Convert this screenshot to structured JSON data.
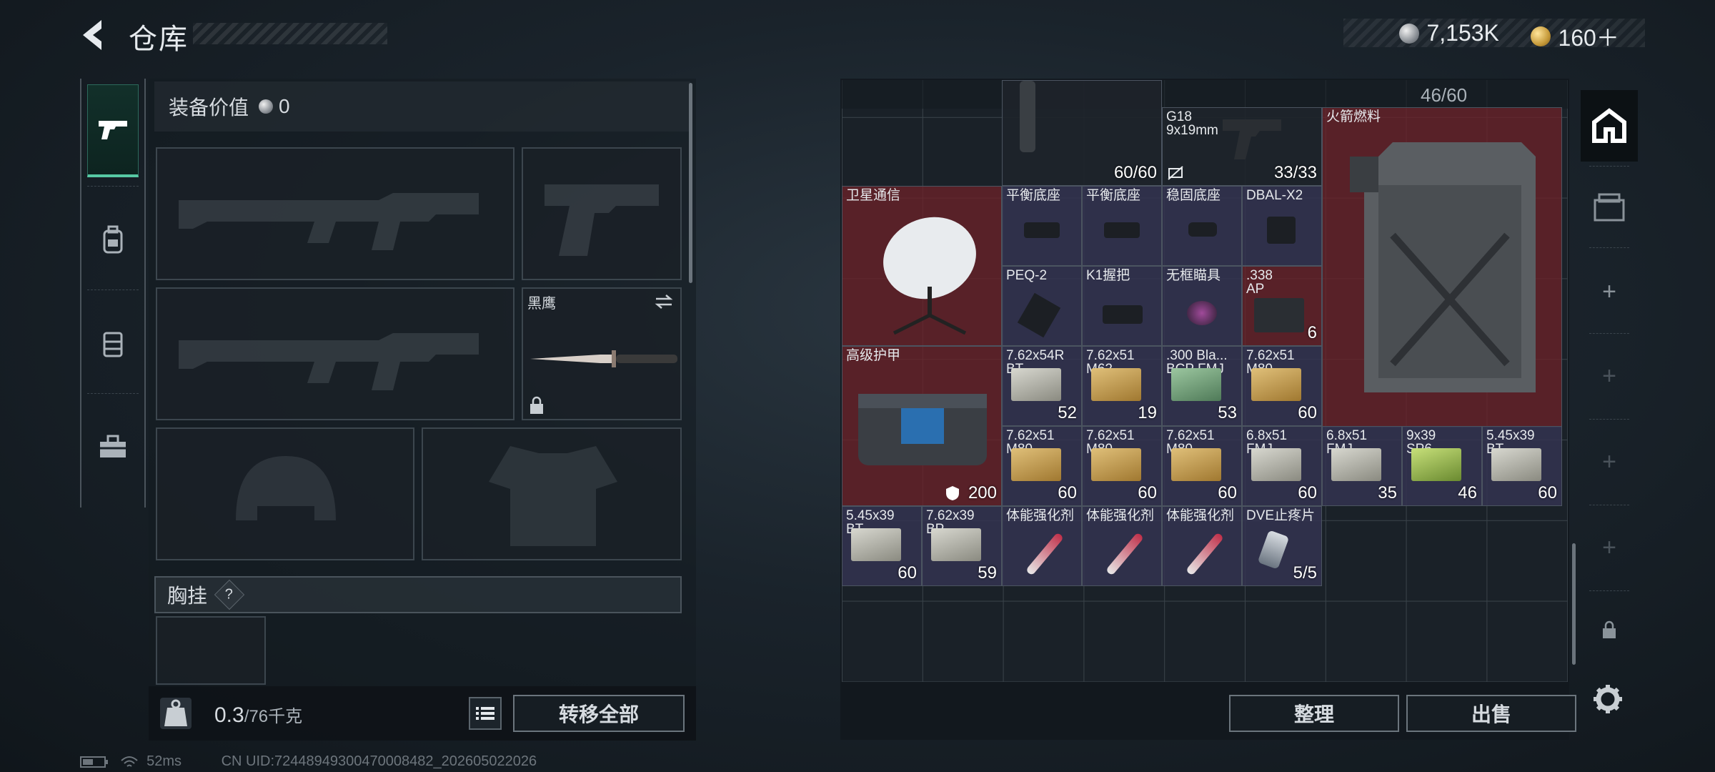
{
  "header": {
    "title": "仓库",
    "silver_amount": "7,153K",
    "gold_amount": "160＋"
  },
  "left_tabs": [
    "weapons",
    "backpack",
    "rig",
    "toolbox"
  ],
  "equipment": {
    "value_label": "装备价值",
    "value_amount": "0",
    "melee_name": "黑鹰",
    "chest_rig_label": "胸挂",
    "question_mark": "?",
    "weight_current": "0.3",
    "weight_max": "/76千克",
    "transfer_all_label": "转移全部"
  },
  "status": {
    "ping": "52ms",
    "uid": "CN UID:7244894930047000848​2_202605022026"
  },
  "stash": {
    "top_counter": "46/60",
    "items": [
      {
        "name": "",
        "count": "60/60",
        "color": "dark"
      },
      {
        "name": "G18\n9x19mm",
        "count": "33/33",
        "color": "dark"
      },
      {
        "name": "火箭燃料",
        "count": "",
        "color": "red"
      },
      {
        "name": "卫星通信",
        "count": "",
        "color": "red"
      },
      {
        "name": "平衡底座",
        "count": "",
        "color": "purple"
      },
      {
        "name": "平衡底座",
        "count": "",
        "color": "purple"
      },
      {
        "name": "稳固底座",
        "count": "",
        "color": "purple"
      },
      {
        "name": "DBAL-X2",
        "count": "",
        "color": "purple"
      },
      {
        "name": "PEQ-2",
        "count": "",
        "color": "purple"
      },
      {
        "name": "K1握把",
        "count": "",
        "color": "purple"
      },
      {
        "name": "无框瞄具",
        "count": "",
        "color": "purple"
      },
      {
        "name": ".338\nAP",
        "count": "6",
        "color": "red"
      },
      {
        "name": "高级护甲",
        "count": "200",
        "color": "red"
      },
      {
        "name": "7.62x54R\nBT",
        "count": "52",
        "color": "purple"
      },
      {
        "name": "7.62x51\nM62",
        "count": "19",
        "color": "purple"
      },
      {
        "name": ".300 Bla...\nBCP FMJ",
        "count": "53",
        "color": "purple"
      },
      {
        "name": "7.62x51\nM80",
        "count": "60",
        "color": "purple"
      },
      {
        "name": "7.62x51\nM80",
        "count": "60",
        "color": "purple"
      },
      {
        "name": "7.62x51\nM80",
        "count": "60",
        "color": "purple"
      },
      {
        "name": "7.62x51\nM80",
        "count": "60",
        "color": "purple"
      },
      {
        "name": "6.8x51\nFMJ",
        "count": "60",
        "color": "purple"
      },
      {
        "name": "6.8x51\nFMJ",
        "count": "35",
        "color": "purple"
      },
      {
        "name": "9x39\nSP6",
        "count": "46",
        "color": "purple"
      },
      {
        "name": "5.45x39\nBT",
        "count": "60",
        "color": "purple"
      },
      {
        "name": "5.45x39\nBT",
        "count": "60",
        "color": "purple"
      },
      {
        "name": "7.62x39\nBP",
        "count": "59",
        "color": "purple"
      },
      {
        "name": "体能强化剂",
        "count": "",
        "color": "purple"
      },
      {
        "name": "体能强化剂",
        "count": "",
        "color": "purple"
      },
      {
        "name": "体能强化剂",
        "count": "",
        "color": "purple"
      },
      {
        "name": "DVE止疼片",
        "count": "5/5",
        "color": "purple"
      }
    ],
    "organize_label": "整理",
    "sell_label": "出售"
  }
}
